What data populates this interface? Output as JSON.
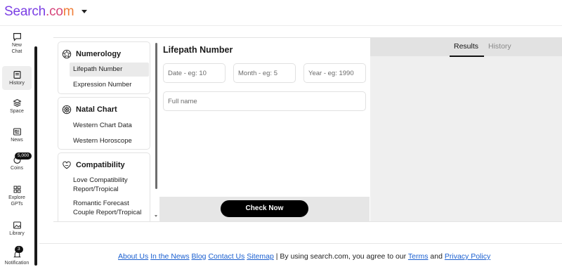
{
  "header": {
    "logo_part1": "Search",
    "logo_part2": ".co",
    "logo_part3": "m",
    "colors": {
      "brand_purple": "#7b3fe4",
      "brand_pink": "#d6457a",
      "brand_orange": "#f07f3a"
    }
  },
  "rail": {
    "items": [
      {
        "icon": "chat-bubble-icon",
        "label_1": "New",
        "label_2": "Chat"
      },
      {
        "icon": "history-icon",
        "label_1": "History"
      },
      {
        "icon": "layers-icon",
        "label_1": "Space"
      },
      {
        "icon": "news-icon",
        "label_1": "News"
      },
      {
        "icon": "coins-icon",
        "label_1": "Coins",
        "badge": "5,000"
      },
      {
        "icon": "grid-icon",
        "label_1": "Explore",
        "label_2": "GPTs"
      },
      {
        "icon": "image-icon",
        "label_1": "Library"
      },
      {
        "icon": "bell-icon",
        "label_1": "Notification",
        "badge": "3"
      }
    ]
  },
  "categories": [
    {
      "title": "Numerology",
      "icon": "numerology-icon",
      "items": [
        "Lifepath Number",
        "Expression Number"
      ],
      "selected": "Lifepath Number"
    },
    {
      "title": "Natal Chart",
      "icon": "zodiac-wheel-icon",
      "items": [
        "Western Chart Data",
        "Western Horoscope"
      ]
    },
    {
      "title": "Compatibility",
      "icon": "hearts-icon",
      "items": [
        "Love Compatibility Report/Tropical",
        "Romantic Forecast Couple Report/Tropical"
      ]
    }
  ],
  "form": {
    "title": "Lifepath Number",
    "date_placeholder": "Date - eg: 10",
    "month_placeholder": "Month - eg: 5",
    "year_placeholder": "Year - eg: 1990",
    "name_placeholder": "Full name",
    "submit_label": "Check Now"
  },
  "results": {
    "tabs": [
      "Results",
      "History"
    ],
    "active_tab": "Results"
  },
  "footer": {
    "links": [
      "About Us",
      "In the News",
      "Blog",
      "Contact Us",
      "Sitemap"
    ],
    "separator": "|",
    "text_before_terms": "By using search.com, you agree to our",
    "terms": "Terms",
    "and": "and",
    "privacy": "Privacy Policy"
  }
}
